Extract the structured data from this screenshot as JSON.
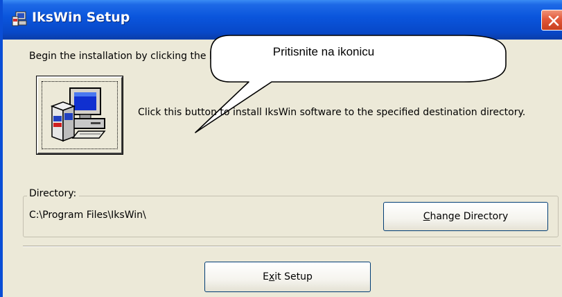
{
  "window": {
    "title": "IksWin Setup",
    "title_icon": "setup-icon",
    "close_icon": "close-icon",
    "colors": {
      "titlebar": "#0a55dc",
      "background": "#ece9d8",
      "close_button": "#e2583a"
    }
  },
  "intro": {
    "text": "Begin the installation by clicking the button below."
  },
  "install": {
    "icon": "computer-install-icon",
    "description": "Click this button to install IksWin software to the specified destination directory."
  },
  "callout": {
    "text": "Pritisnite na ikonicu"
  },
  "directory": {
    "label": "Directory:",
    "path": "C:\\Program Files\\IksWin\\",
    "change_button": {
      "mnemonic": "C",
      "rest": "hange Directory"
    }
  },
  "exit_button": {
    "before": "E",
    "mnemonic": "x",
    "after": "it Setup"
  }
}
